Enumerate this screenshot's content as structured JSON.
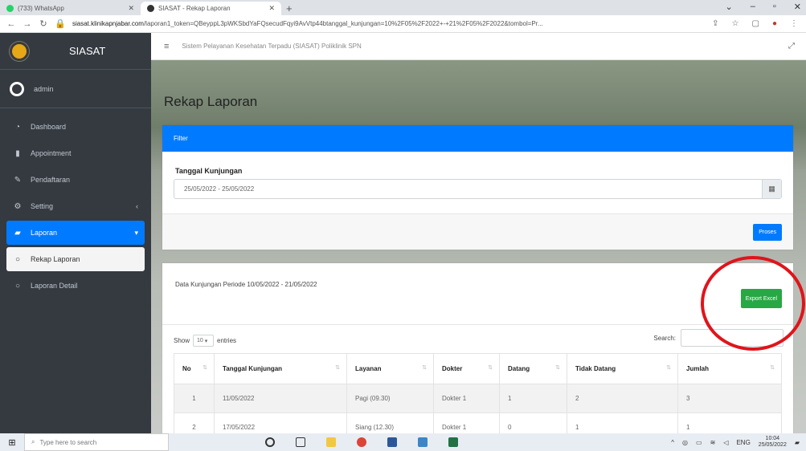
{
  "browser": {
    "tabs": [
      {
        "label": "(733) WhatsApp",
        "favicon_color": "#25d366"
      },
      {
        "label": "SIASAT - Rekap Laporan",
        "favicon_color": "#333333"
      }
    ],
    "new_tab": "+",
    "url_domain": "siasat.klinikapnjabar.com",
    "url_path": "/laporan1_token=QBeyppL3pWKSbdYaFQsecudFqyi9AvVtp44btanggal_kunjungan=10%2F05%2F2022+-+21%2F05%2F2022&tombol=Pr..."
  },
  "sidebar": {
    "brand": "SIASAT",
    "user": "admin",
    "items": [
      {
        "label": "Dashboard",
        "icon": "dashboard-icon"
      },
      {
        "label": "Appointment",
        "icon": "file-icon"
      },
      {
        "label": "Pendaftaran",
        "icon": "edit-icon"
      },
      {
        "label": "Setting",
        "icon": "gear-icon"
      },
      {
        "label": "Laporan",
        "icon": "book-icon"
      },
      {
        "label": "Rekap Laporan",
        "icon": "circle-icon"
      },
      {
        "label": "Laporan Detail",
        "icon": "circle-icon"
      }
    ]
  },
  "topnav": {
    "title": "Sistem Pelayanan Kesehatan Terpadu (SIASAT) Poliklinik SPN"
  },
  "page": {
    "title": "Rekap Laporan"
  },
  "filter": {
    "header": "Filter",
    "label": "Tanggal Kunjungan",
    "value": "25/05/2022 - 25/05/2022",
    "submit": "Proses"
  },
  "data_card": {
    "title": "Data Kunjungan Periode 10/05/2022 - 21/05/2022",
    "export": "Export Excel",
    "show_label": "Show",
    "show_value": "10",
    "entries_label": "entries",
    "search_label": "Search:",
    "columns": [
      "No",
      "Tanggal Kunjungan",
      "Layanan",
      "Dokter",
      "Datang",
      "Tidak Datang",
      "Jumlah"
    ],
    "rows": [
      [
        "1",
        "11/05/2022",
        "Pagi (09.30)",
        "Dokter 1",
        "1",
        "2",
        "3"
      ],
      [
        "2",
        "17/05/2022",
        "Siang (12.30)",
        "Dokter 1",
        "0",
        "1",
        "1"
      ]
    ]
  },
  "taskbar": {
    "search_placeholder": "Type here to search",
    "time": "10:04",
    "date": "25/05/2022"
  },
  "colors": {
    "primary": "#007bff",
    "success": "#28a745",
    "sidebar": "#343a40",
    "highlight_circle": "#e0141b"
  }
}
